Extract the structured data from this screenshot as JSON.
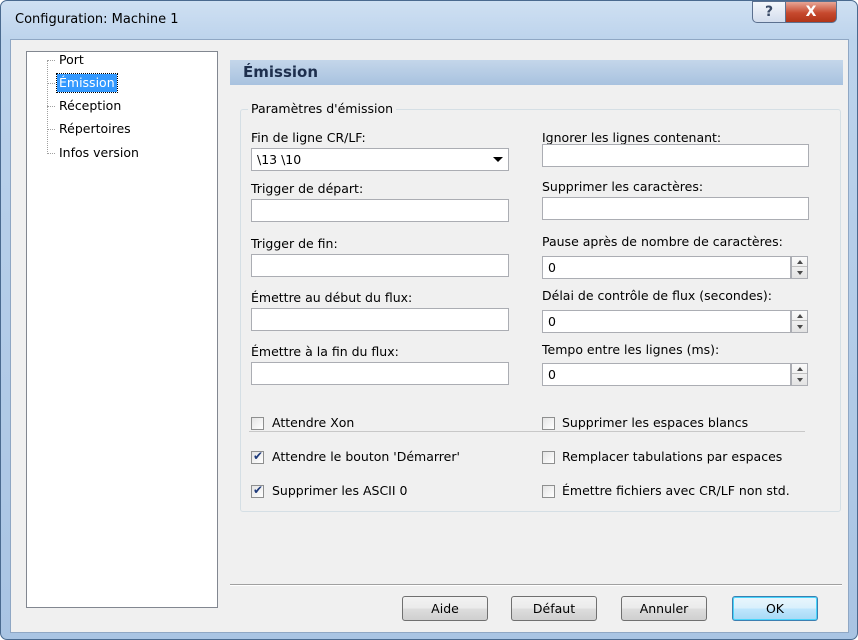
{
  "window": {
    "title": "Configuration: Machine 1",
    "help_label": "?",
    "close_label": "X"
  },
  "tree": {
    "items": [
      "Port",
      "Émission",
      "Réception",
      "Répertoires",
      "Infos version"
    ],
    "selected": "Émission"
  },
  "panel": {
    "title": "Émission",
    "group_title": "Paramètres d'émission"
  },
  "fields": {
    "line_end_label": "Fin de ligne CR/LF:",
    "line_end_value": "\\13 \\10",
    "start_trigger_label": "Trigger de départ:",
    "start_trigger_value": "",
    "end_trigger_label": "Trigger de fin:",
    "end_trigger_value": "",
    "emit_start_label": "Émettre au début du flux:",
    "emit_start_value": "",
    "emit_end_label": "Émettre à la fin du flux:",
    "emit_end_value": "",
    "ignore_lines_label": "Ignorer les lignes contenant:",
    "ignore_lines_value": "",
    "remove_chars_label": "Supprimer les caractères:",
    "remove_chars_value": "",
    "pause_label": "Pause après de nombre de caractères:",
    "pause_value": "0",
    "flow_delay_label": "Délai de contrôle de flux (secondes):",
    "flow_delay_value": "0",
    "line_delay_label": "Tempo entre les lignes (ms):",
    "line_delay_value": "0"
  },
  "checkboxes": {
    "wait_xon": {
      "label": "Attendre Xon",
      "checked": false
    },
    "wait_start": {
      "label": "Attendre le bouton 'Démarrer'",
      "checked": true
    },
    "remove_ascii0": {
      "label": "Supprimer les ASCII 0",
      "checked": true
    },
    "remove_blanks": {
      "label": "Supprimer les espaces blancs",
      "checked": false
    },
    "replace_tabs": {
      "label": "Remplacer tabulations par espaces",
      "checked": false
    },
    "nonstd_crlf": {
      "label": "Émettre fichiers avec CR/LF non std.",
      "checked": false
    }
  },
  "buttons": {
    "help": "Aide",
    "default": "Défaut",
    "cancel": "Annuler",
    "ok": "OK"
  },
  "colors": {
    "selection": "#3399ff",
    "header_gradient_top": "#c4d6ea",
    "close_red": "#c6492e"
  }
}
